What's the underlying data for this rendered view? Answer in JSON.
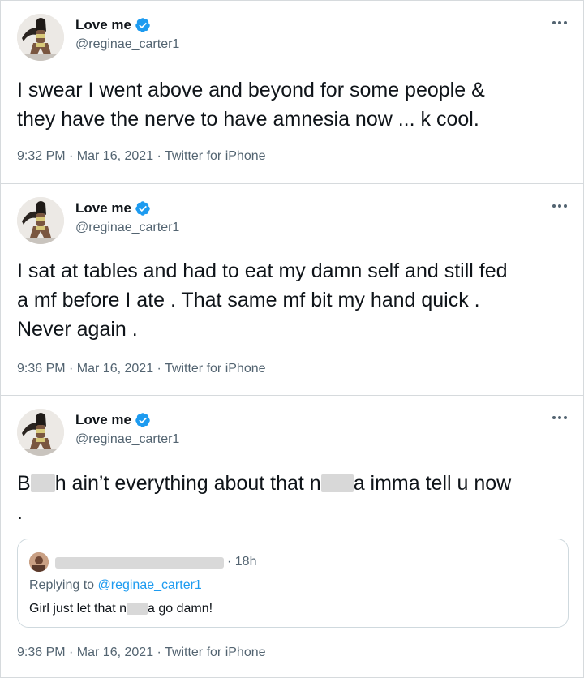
{
  "colors": {
    "verified_blue": "#1d9bf0",
    "secondary_text": "#536471",
    "primary_text": "#0f1419",
    "border": "#d6dadd"
  },
  "tweets": [
    {
      "display_name": "Love me",
      "handle": "@reginae_carter1",
      "text_lines": [
        "I swear I went above and beyond for some people &",
        "they have the nerve to have amnesia now ... k cool."
      ],
      "timestamp": "9:32 PM · Mar 16, 2021 · Twitter for iPhone"
    },
    {
      "display_name": "Love me",
      "handle": "@reginae_carter1",
      "text_lines": [
        "I sat at tables and had to eat my damn self and still fed",
        "a mf before I ate . That same mf bit my hand quick .",
        "Never again ."
      ],
      "timestamp": "9:36 PM · Mar 16, 2021 · Twitter for iPhone"
    },
    {
      "display_name": "Love me",
      "handle": "@reginae_carter1",
      "text": {
        "part1": "B",
        "part2": "h ain’t everything about that n",
        "part3": "a imma tell u now",
        "line2": "."
      },
      "timestamp": "9:36 PM · Mar 16, 2021 · Twitter for iPhone",
      "quoted": {
        "time": "· 18h",
        "replying_prefix": "Replying to ",
        "replying_handle": "@reginae_carter1",
        "text_part1": "Girl just let that n",
        "text_part2": "a go damn!"
      }
    }
  ],
  "icons": {
    "verified": "verified-badge-icon",
    "more": "more-options-icon"
  }
}
